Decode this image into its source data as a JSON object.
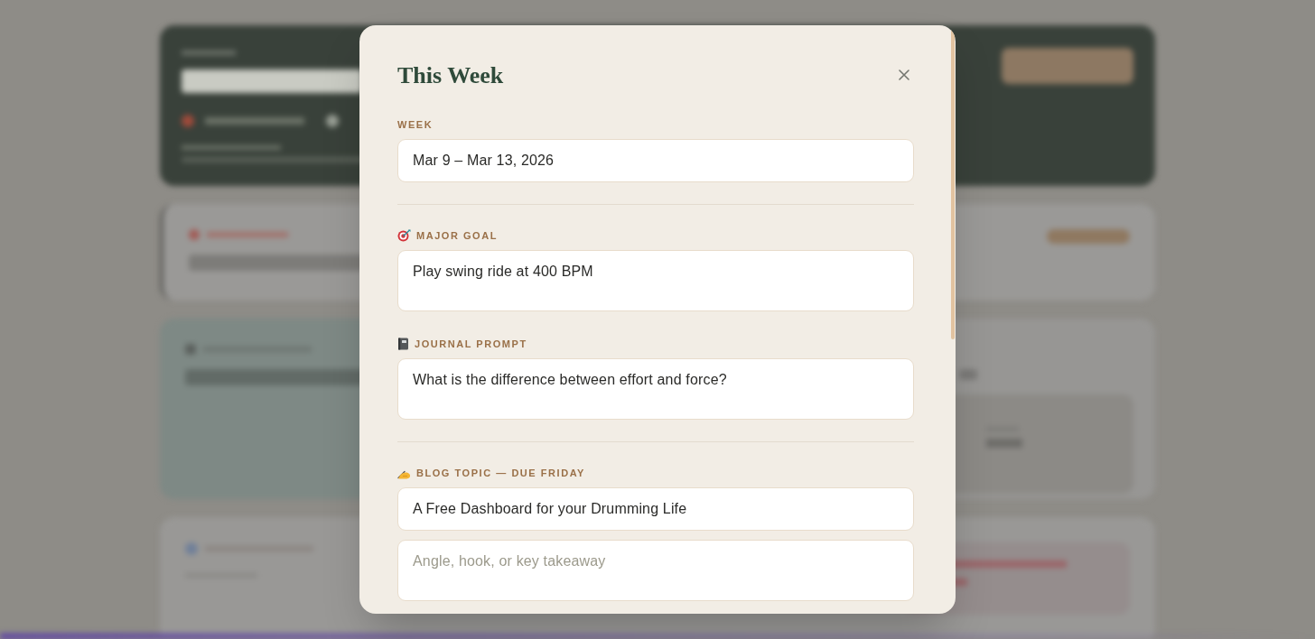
{
  "dialog": {
    "title": "This Week",
    "groups": [
      [
        {
          "label": "WEEK",
          "fields": [
            {
              "kind": "input",
              "value": "Mar 9 – Mar 13, 2026"
            }
          ]
        }
      ],
      [
        {
          "label": "MAJOR GOAL",
          "fields": [
            {
              "kind": "textarea",
              "value": "Play swing ride at 400 BPM"
            }
          ]
        },
        {
          "label": "JOURNAL PROMPT",
          "fields": [
            {
              "kind": "textarea",
              "value": "What is the difference between effort and force?"
            }
          ]
        }
      ],
      [
        {
          "label": "BLOG TOPIC — DUE FRIDAY",
          "fields": [
            {
              "kind": "input",
              "value": "A Free Dashboard for your Drumming Life"
            },
            {
              "kind": "textarea",
              "placeholder": "Angle, hook, or key takeaway"
            }
          ]
        }
      ]
    ]
  }
}
